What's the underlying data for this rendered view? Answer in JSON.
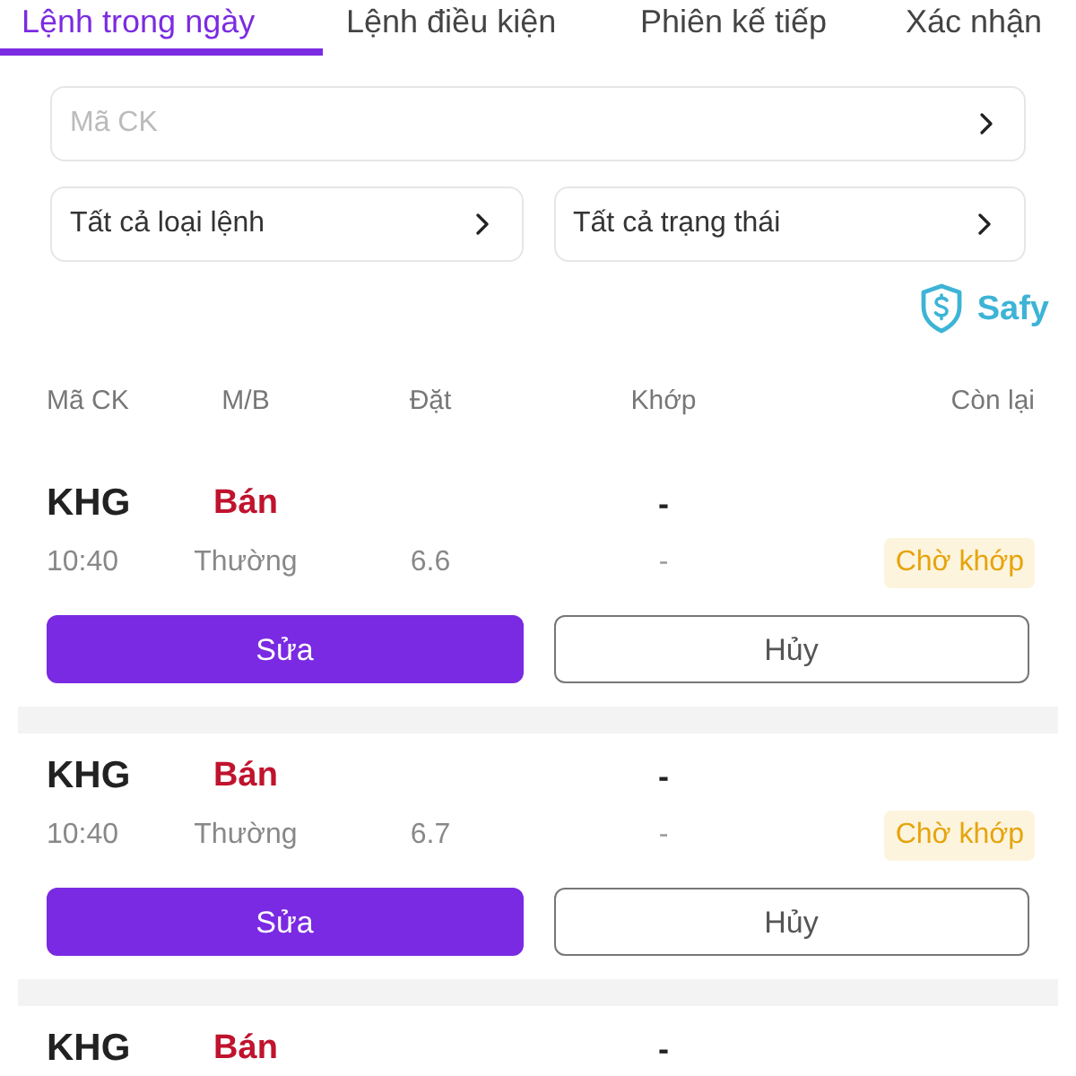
{
  "tabs": [
    {
      "label": "Lệnh trong ngày",
      "selected": true
    },
    {
      "label": "Lệnh điều kiện",
      "selected": false
    },
    {
      "label": "Phiên kế tiếp",
      "selected": false
    },
    {
      "label": "Xác nhận",
      "selected": false
    }
  ],
  "search_field": {
    "placeholder": "Mã CK"
  },
  "filters": [
    {
      "label": "Tất cả loại lệnh"
    },
    {
      "label": "Tất cả trạng thái"
    }
  ],
  "brand": {
    "name": "Safy"
  },
  "columns": [
    "Mã CK",
    "M/B",
    "Đặt",
    "Khớp",
    "Còn lại"
  ],
  "orders": [
    {
      "symbol": "KHG",
      "side": "Bán",
      "matched": "-",
      "time": "10:40",
      "type": "Thường",
      "price": "6.6",
      "matched_price": "-",
      "status": "Chờ khớp",
      "actions": [
        {
          "label": "Sửa",
          "kind": "primary"
        },
        {
          "label": "Hủy",
          "kind": "outline"
        }
      ]
    },
    {
      "symbol": "KHG",
      "side": "Bán",
      "matched": "-",
      "time": "10:40",
      "type": "Thường",
      "price": "6.7",
      "matched_price": "-",
      "status": "Chờ khớp",
      "actions": [
        {
          "label": "Sửa",
          "kind": "primary"
        },
        {
          "label": "Hủy",
          "kind": "outline"
        }
      ]
    },
    {
      "symbol": "KHG",
      "side": "Bán",
      "matched": "-"
    }
  ]
}
